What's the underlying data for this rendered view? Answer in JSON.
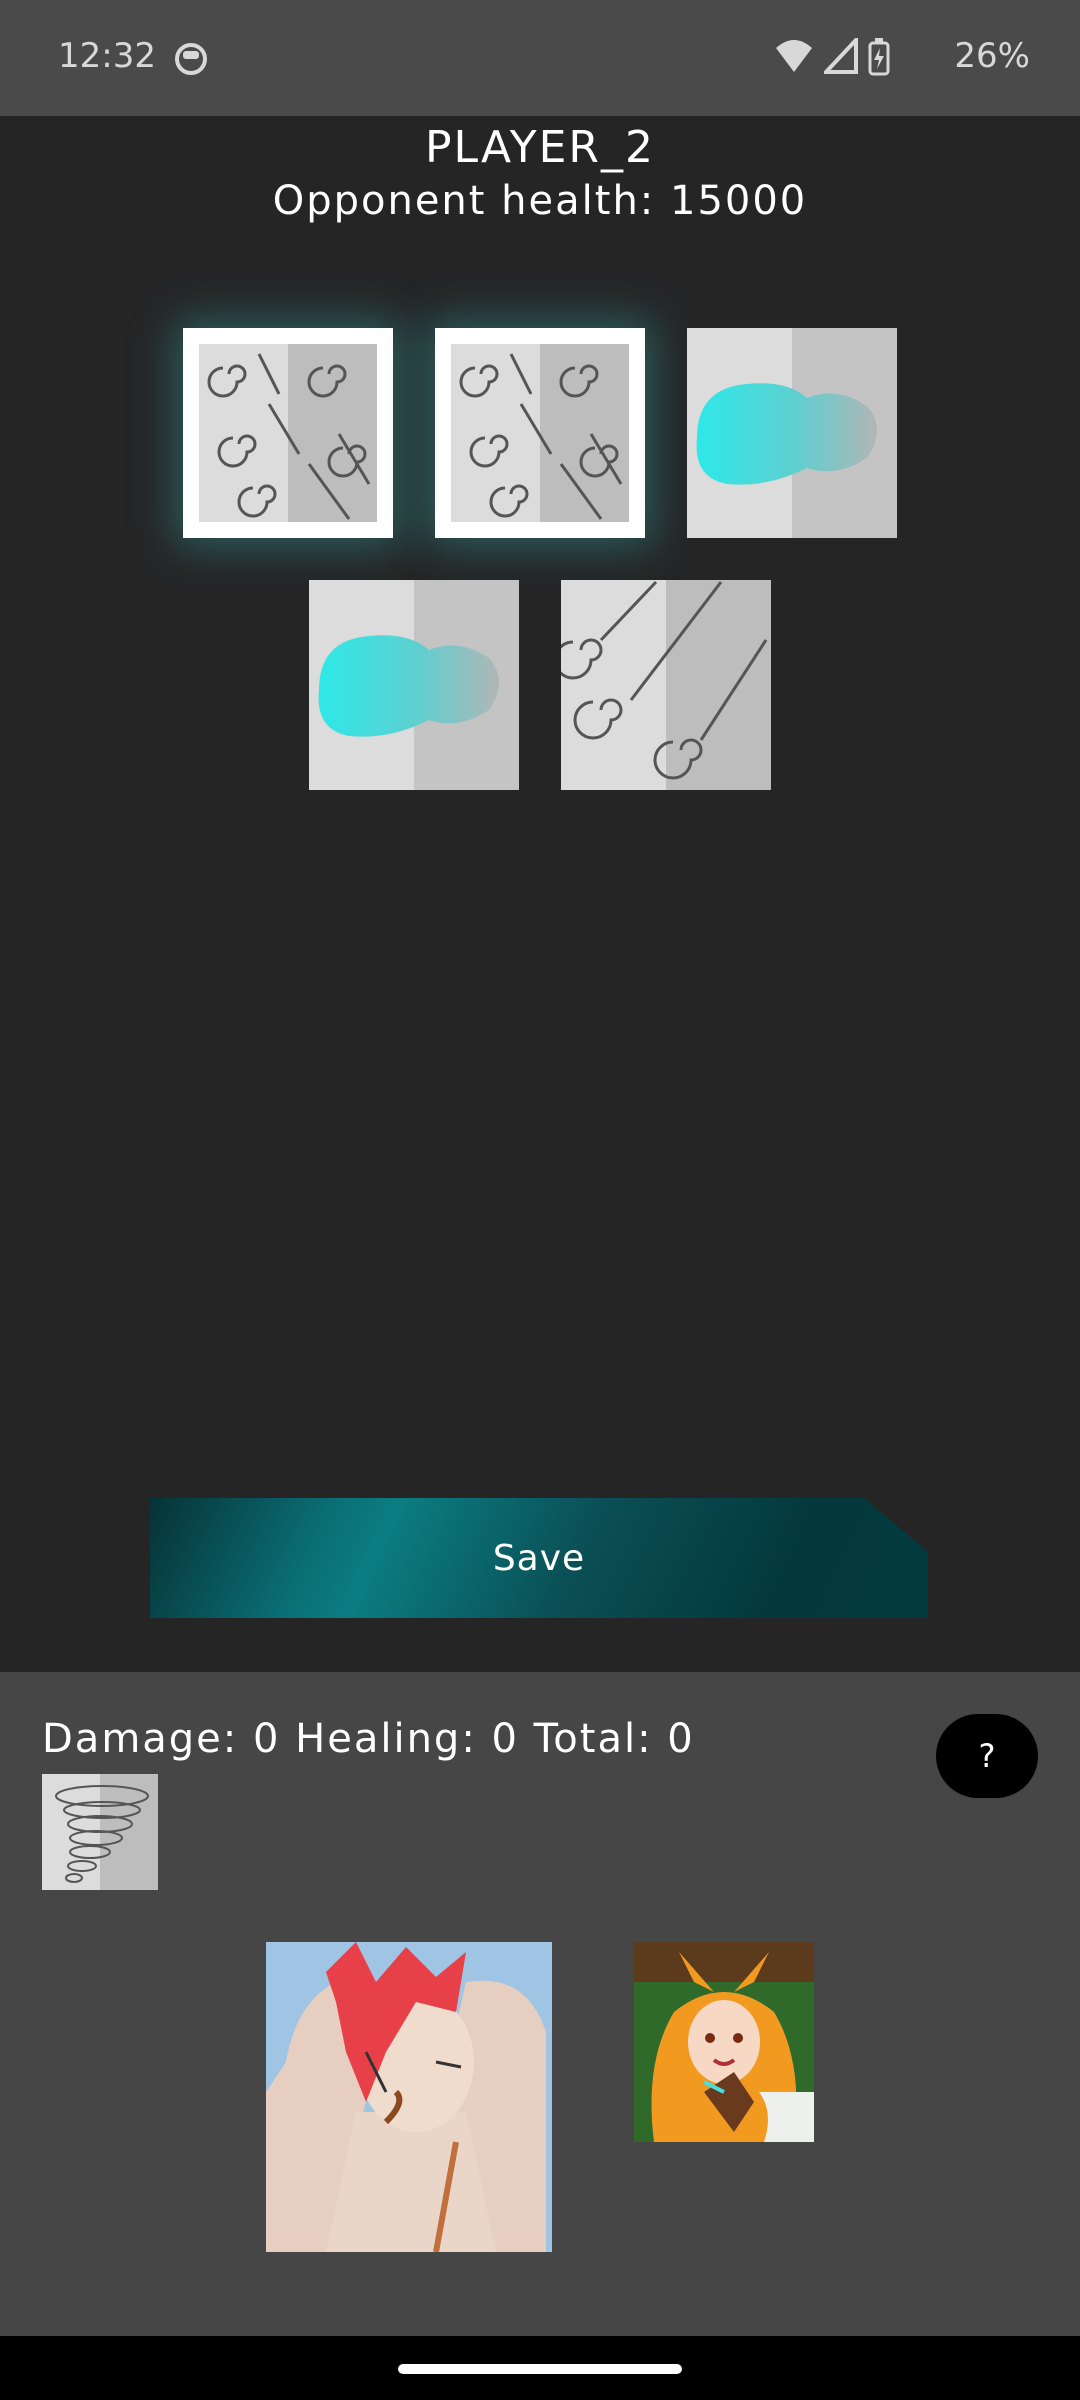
{
  "status_bar": {
    "time": "12:32",
    "battery": "26%"
  },
  "header": {
    "player_name": "PLAYER_2",
    "opponent_health": "Opponent health: 15000"
  },
  "hand": [
    {
      "type": "wind",
      "selected": true
    },
    {
      "type": "wind",
      "selected": true
    },
    {
      "type": "water",
      "selected": false
    },
    {
      "type": "water",
      "selected": false
    },
    {
      "type": "wind",
      "selected": false
    }
  ],
  "actions": {
    "save_label": "Save"
  },
  "stats": {
    "text": "Damage: 0 Healing: 0 Total: 0"
  },
  "help": {
    "label": "?"
  },
  "colors": {
    "accent": "#0b7d82",
    "background": "#252526",
    "panel": "#464646"
  }
}
